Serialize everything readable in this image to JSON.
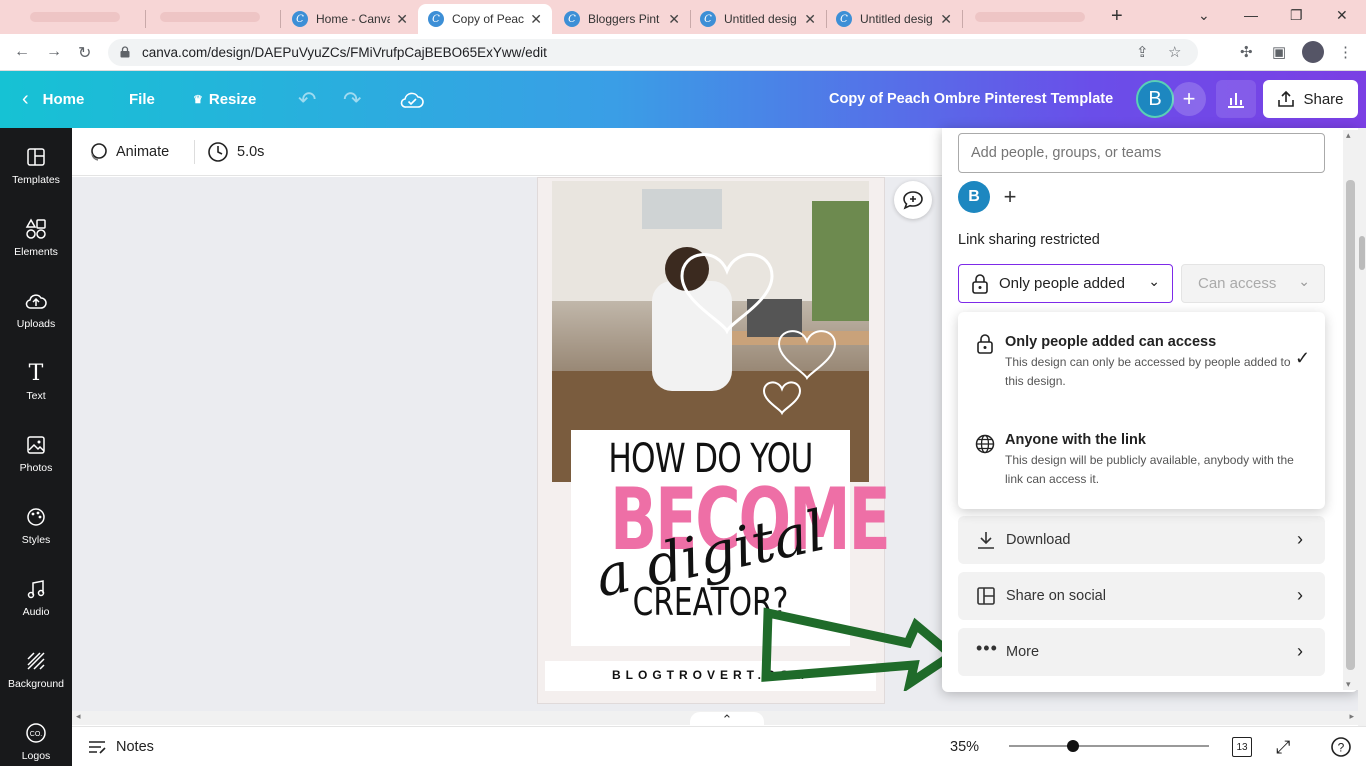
{
  "browser": {
    "tabs": [
      {
        "label": "Home - Canva",
        "active": false
      },
      {
        "label": "Copy of Peach",
        "active": true
      },
      {
        "label": "Bloggers Pint",
        "active": false
      },
      {
        "label": "Untitled desig",
        "active": false
      },
      {
        "label": "Untitled desig",
        "active": false
      }
    ],
    "new_tab": "+",
    "url": "canva.com/design/DAEPuVyuZCs/FMiVrufpCajBEBO65ExYww/edit"
  },
  "app": {
    "home": "Home",
    "file": "File",
    "resize": "Resize",
    "doc_title": "Copy of Peach Ombre Pinterest Template",
    "avatar_letter": "B",
    "share": "Share"
  },
  "sidebar": {
    "items": [
      {
        "label": "Templates",
        "icon": "templates-icon"
      },
      {
        "label": "Elements",
        "icon": "elements-icon"
      },
      {
        "label": "Uploads",
        "icon": "uploads-icon"
      },
      {
        "label": "Text",
        "icon": "text-icon"
      },
      {
        "label": "Photos",
        "icon": "photos-icon"
      },
      {
        "label": "Styles",
        "icon": "styles-icon"
      },
      {
        "label": "Audio",
        "icon": "audio-icon"
      },
      {
        "label": "Background",
        "icon": "background-icon"
      },
      {
        "label": "Logos",
        "icon": "logos-icon"
      }
    ]
  },
  "toolbar": {
    "animate": "Animate",
    "duration": "5.0s"
  },
  "design": {
    "line1": "HOW DO YOU",
    "line2": "BECOME",
    "line3": "a digital",
    "line4": "CREATOR?",
    "footer": "BLOGTROVERT.COM"
  },
  "bottom": {
    "notes": "Notes",
    "zoom": "35%",
    "page_count": "13",
    "zoom_fraction": 0.35
  },
  "share_panel": {
    "people_placeholder": "Add people, groups, or teams",
    "avatar_letter": "B",
    "link_sharing": "Link sharing restricted",
    "select_value": "Only people added",
    "access_value": "Can access",
    "options": [
      {
        "title": "Only people added can access",
        "desc": "This design can only be accessed by people added to this design.",
        "selected": true
      },
      {
        "title": "Anyone with the link",
        "desc": "This design will be publicly available, anybody with the link can access it.",
        "selected": false
      }
    ],
    "rows": [
      {
        "label": "Download"
      },
      {
        "label": "Share on social"
      },
      {
        "label": "More"
      }
    ]
  },
  "colors": {
    "accent_purple": "#7d2ae8",
    "avatar_blue": "#1d87c0",
    "pink": "#ee6fa6",
    "arrow_green": "#1f6b2a"
  }
}
